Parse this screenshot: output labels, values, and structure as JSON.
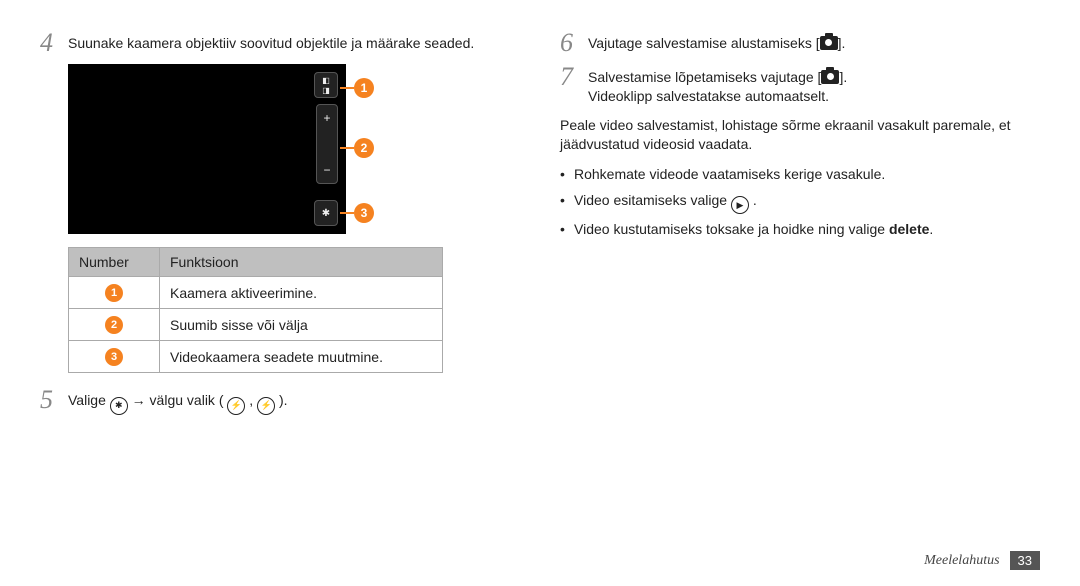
{
  "left": {
    "step4_num": "4",
    "step4_text": "Suunake kaamera objektiiv soovitud objektile ja määrake seaded.",
    "callouts": {
      "c1": "1",
      "c2": "2",
      "c3": "3"
    },
    "screen_btns": {
      "b1_name": "switch-camera-icon",
      "b2_plus": "+",
      "b2_minus": "−",
      "b3_name": "settings-gear-icon"
    },
    "table": {
      "h_num": "Number",
      "h_func": "Funktsioon",
      "rows": [
        {
          "n": "1",
          "f": "Kaamera aktiveerimine."
        },
        {
          "n": "2",
          "f": "Suumib sisse või välja"
        },
        {
          "n": "3",
          "f": "Videokaamera seadete muutmine."
        }
      ]
    },
    "step5_num": "5",
    "step5_a": "Valige ",
    "step5_b": " → välgu valik (",
    "step5_c": ", ",
    "step5_d": ")."
  },
  "right": {
    "step6_num": "6",
    "step6_a": "Vajutage salvestamise alustamiseks [",
    "step6_b": "].",
    "step7_num": "7",
    "step7_line1a": "Salvestamise lõpetamiseks vajutage [",
    "step7_line1b": "].",
    "step7_line2": "Videoklipp salvestatakse automaatselt.",
    "para": "Peale video salvestamist, lohistage sõrme ekraanil vasakult paremale, et jäädvustatud videosid vaadata.",
    "bullets": {
      "b1": "Rohkemate videode vaatamiseks kerige vasakule.",
      "b2a": "Video esitamiseks valige ",
      "b2b": ".",
      "b3a": "Video kustutamiseks toksake ja hoidke ning valige ",
      "b3_bold": "delete",
      "b3b": "."
    }
  },
  "footer": {
    "section": "Meelelahutus",
    "page": "33"
  },
  "icons": {
    "gear": "✱",
    "flash_on": "⚡",
    "flash_off": "⚡",
    "play": "▶"
  }
}
